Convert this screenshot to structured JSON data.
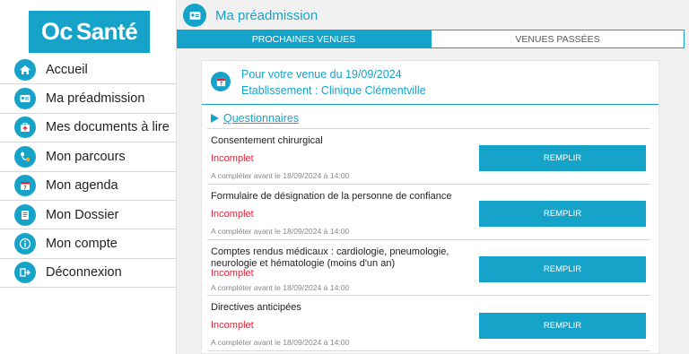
{
  "brand": {
    "logo_oc": "Oc",
    "logo_text": "Santé",
    "accent": "#16a3c9",
    "error": "#e2263a"
  },
  "sidebar": {
    "items": [
      {
        "label": "Accueil",
        "icon": "home-icon"
      },
      {
        "label": "Ma préadmission",
        "icon": "id-card-icon"
      },
      {
        "label": "Mes documents à lire",
        "icon": "medical-kit-icon"
      },
      {
        "label": "Mon parcours",
        "icon": "route-icon"
      },
      {
        "label": "Mon agenda",
        "icon": "calendar-icon"
      },
      {
        "label": "Mon Dossier",
        "icon": "folder-icon"
      },
      {
        "label": "Mon compte",
        "icon": "info-icon"
      },
      {
        "label": "Déconnexion",
        "icon": "logout-icon"
      }
    ]
  },
  "header": {
    "title": "Ma préadmission"
  },
  "tabs": [
    {
      "label": "PROCHAINES VENUES",
      "active": true
    },
    {
      "label": "VENUES PASSÉES",
      "active": false
    }
  ],
  "card": {
    "visit_line": "Pour votre venue du 19/09/2024",
    "establishment_line": "Etablissement : Clinique Clémentville",
    "calendar_day": "7",
    "questionnaires_label": "Questionnaires",
    "items": [
      {
        "name": "Consentement chirurgical",
        "status": "Incomplet",
        "due": "A compléter avant le 18/09/2024 à 14:00",
        "button": "REMPLIR"
      },
      {
        "name": "Formulaire de désignation de la personne de confiance",
        "status": "Incomplet",
        "due": "A compléter avant le 18/09/2024 à 14:00",
        "button": "REMPLIR"
      },
      {
        "name": "Comptes rendus médicaux : cardiologie, pneumologie, neurologie et hématologie (moins d'un an)",
        "status": "Incomplet",
        "due": "A compléter avant le 18/09/2024 à 14:00",
        "button": "REMPLIR"
      },
      {
        "name": "Directives anticipées",
        "status": "Incomplet",
        "due": "A compléter avant le 18/09/2024 à 14:00",
        "button": "REMPLIR"
      }
    ]
  }
}
